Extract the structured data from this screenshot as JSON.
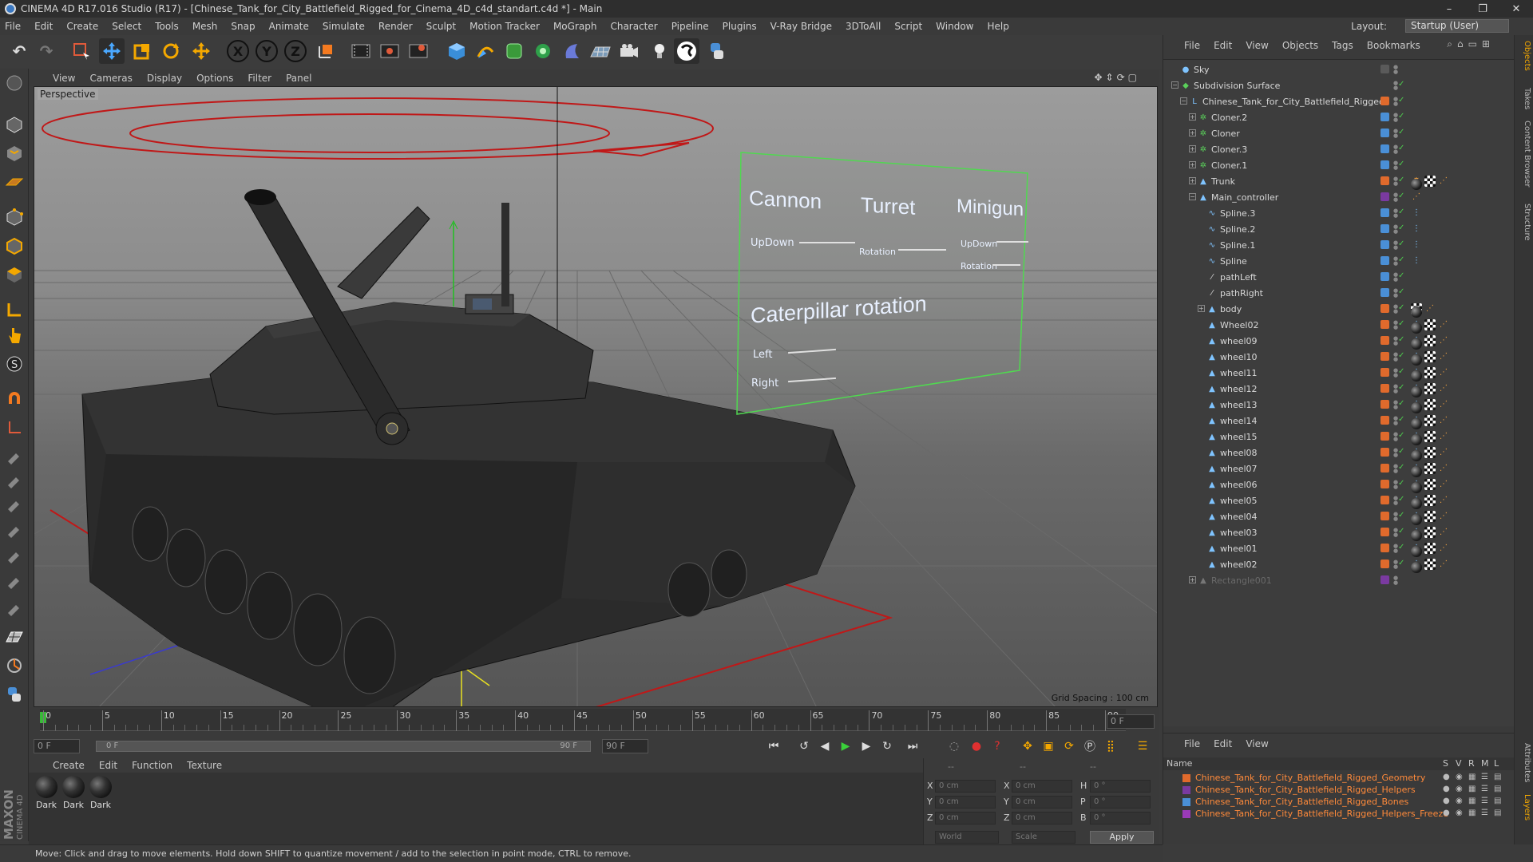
{
  "window": {
    "title": "CINEMA 4D R17.016 Studio (R17) - [Chinese_Tank_for_City_Battlefield_Rigged_for_Cinema_4D_c4d_standart.c4d *] - Main",
    "controls": [
      "–",
      "❐",
      "✕"
    ]
  },
  "menu": {
    "items": [
      "File",
      "Edit",
      "Create",
      "Select",
      "Tools",
      "Mesh",
      "Snap",
      "Animate",
      "Simulate",
      "Render",
      "Sculpt",
      "Motion Tracker",
      "MoGraph",
      "Character",
      "Pipeline",
      "Plugins",
      "V-Ray Bridge",
      "3DToAll",
      "Script",
      "Window",
      "Help"
    ],
    "layout_label": "Layout:",
    "layout_value": "Startup (User)"
  },
  "toolbar": {
    "axis_x": "X",
    "axis_y": "Y",
    "axis_z": "Z"
  },
  "viewport": {
    "menu": [
      "View",
      "Cameras",
      "Display",
      "Options",
      "Filter",
      "Panel"
    ],
    "label": "Perspective",
    "grid_spacing": "Grid Spacing : 100 cm",
    "hud": {
      "cannon": "Cannon",
      "turret": "Turret",
      "minigun": "Minigun",
      "updown1": "UpDown",
      "rotation1": "Rotation",
      "updown2": "UpDown",
      "rotation2": "Rotation",
      "caterpillar": "Caterpillar rotation",
      "left": "Left",
      "right": "Right"
    }
  },
  "timeline": {
    "ticks": [
      "0",
      "5",
      "10",
      "15",
      "20",
      "25",
      "30",
      "35",
      "40",
      "45",
      "50",
      "55",
      "60",
      "65",
      "70",
      "75",
      "80",
      "85",
      "90"
    ],
    "current_frame": "0 F",
    "start_field": "0 F",
    "range_start": "0 F",
    "range_end": "90 F",
    "end_field": "90 F"
  },
  "materials": {
    "menu": [
      "Create",
      "Edit",
      "Function",
      "Texture"
    ],
    "items": [
      "Dark",
      "Dark",
      "Dark"
    ],
    "brand": "MAXON",
    "brand2": "CINEMA 4D"
  },
  "coordinates": {
    "col1": [
      "X",
      "Y",
      "Z"
    ],
    "col2": [
      "X",
      "Y",
      "Z"
    ],
    "col3": [
      "H",
      "P",
      "B"
    ],
    "pos": [
      "0 cm",
      "0 cm",
      "0 cm"
    ],
    "size": [
      "0 cm",
      "0 cm",
      "0 cm"
    ],
    "rot": [
      "0 °",
      "0 °",
      "0 °"
    ],
    "mode1": "World",
    "mode2": "Scale",
    "apply": "Apply",
    "header1": "--",
    "header2": "--",
    "header3": "--"
  },
  "status": {
    "text": "Move: Click and drag to move elements. Hold down SHIFT to quantize movement / add to the selection in point mode, CTRL to remove."
  },
  "objects": {
    "menu": [
      "File",
      "Edit",
      "View",
      "Objects",
      "Tags",
      "Bookmarks"
    ],
    "rows": [
      {
        "name": "Sky",
        "indent": 0,
        "layer": "#5a5a5a",
        "exp": ""
      },
      {
        "name": "Subdivision Surface",
        "indent": 0,
        "layer": "",
        "exp": "−"
      },
      {
        "name": "Chinese_Tank_for_City_Battlefield_Rigged",
        "indent": 1,
        "layer": "#e06a2c",
        "exp": "−"
      },
      {
        "name": "Cloner.2",
        "indent": 2,
        "layer": "#4a8fd6",
        "exp": "+"
      },
      {
        "name": "Cloner",
        "indent": 2,
        "layer": "#4a8fd6",
        "exp": "+"
      },
      {
        "name": "Cloner.3",
        "indent": 2,
        "layer": "#4a8fd6",
        "exp": "+"
      },
      {
        "name": "Cloner.1",
        "indent": 2,
        "layer": "#4a8fd6",
        "exp": "+"
      },
      {
        "name": "Trunk",
        "indent": 2,
        "layer": "#e06a2c",
        "exp": "+"
      },
      {
        "name": "Main_controller",
        "indent": 2,
        "layer": "#7a3aa0",
        "exp": "−"
      },
      {
        "name": "Spline.3",
        "indent": 3,
        "layer": "#4a8fd6",
        "exp": ""
      },
      {
        "name": "Spline.2",
        "indent": 3,
        "layer": "#4a8fd6",
        "exp": ""
      },
      {
        "name": "Spline.1",
        "indent": 3,
        "layer": "#4a8fd6",
        "exp": ""
      },
      {
        "name": "Spline",
        "indent": 3,
        "layer": "#4a8fd6",
        "exp": ""
      },
      {
        "name": "pathLeft",
        "indent": 3,
        "layer": "#4a8fd6",
        "exp": ""
      },
      {
        "name": "pathRight",
        "indent": 3,
        "layer": "#4a8fd6",
        "exp": ""
      },
      {
        "name": "body",
        "indent": 3,
        "layer": "#e06a2c",
        "exp": "+"
      },
      {
        "name": "Wheel02",
        "indent": 3,
        "layer": "#e06a2c",
        "exp": ""
      },
      {
        "name": "wheel09",
        "indent": 3,
        "layer": "#e06a2c",
        "exp": ""
      },
      {
        "name": "wheel10",
        "indent": 3,
        "layer": "#e06a2c",
        "exp": ""
      },
      {
        "name": "wheel11",
        "indent": 3,
        "layer": "#e06a2c",
        "exp": ""
      },
      {
        "name": "wheel12",
        "indent": 3,
        "layer": "#e06a2c",
        "exp": ""
      },
      {
        "name": "wheel13",
        "indent": 3,
        "layer": "#e06a2c",
        "exp": ""
      },
      {
        "name": "wheel14",
        "indent": 3,
        "layer": "#e06a2c",
        "exp": ""
      },
      {
        "name": "wheel15",
        "indent": 3,
        "layer": "#e06a2c",
        "exp": ""
      },
      {
        "name": "wheel08",
        "indent": 3,
        "layer": "#e06a2c",
        "exp": ""
      },
      {
        "name": "wheel07",
        "indent": 3,
        "layer": "#e06a2c",
        "exp": ""
      },
      {
        "name": "wheel06",
        "indent": 3,
        "layer": "#e06a2c",
        "exp": ""
      },
      {
        "name": "wheel05",
        "indent": 3,
        "layer": "#e06a2c",
        "exp": ""
      },
      {
        "name": "wheel04",
        "indent": 3,
        "layer": "#e06a2c",
        "exp": ""
      },
      {
        "name": "wheel03",
        "indent": 3,
        "layer": "#e06a2c",
        "exp": ""
      },
      {
        "name": "wheel01",
        "indent": 3,
        "layer": "#e06a2c",
        "exp": ""
      },
      {
        "name": "wheel02",
        "indent": 3,
        "layer": "#e06a2c",
        "exp": ""
      },
      {
        "name": "Rectangle001",
        "indent": 2,
        "layer": "#7a3aa0",
        "exp": "+",
        "dim": true
      }
    ]
  },
  "layers": {
    "menu": [
      "File",
      "Edit",
      "View"
    ],
    "header": "Name",
    "cols": [
      "S",
      "V",
      "R",
      "M",
      "L"
    ],
    "rows": [
      {
        "name": "Chinese_Tank_for_City_Battlefield_Rigged_Geometry",
        "color": "#e06a2c"
      },
      {
        "name": "Chinese_Tank_for_City_Battlefield_Rigged_Helpers",
        "color": "#7a3aa0"
      },
      {
        "name": "Chinese_Tank_for_City_Battlefield_Rigged_Bones",
        "color": "#4a8fd6"
      },
      {
        "name": "Chinese_Tank_for_City_Battlefield_Rigged_Helpers_Freeze",
        "color": "#9a3ab8"
      }
    ]
  },
  "right_tabs": [
    "Objects",
    "Takes",
    "Content Browser",
    "Structure",
    "Attributes",
    "Layers"
  ]
}
